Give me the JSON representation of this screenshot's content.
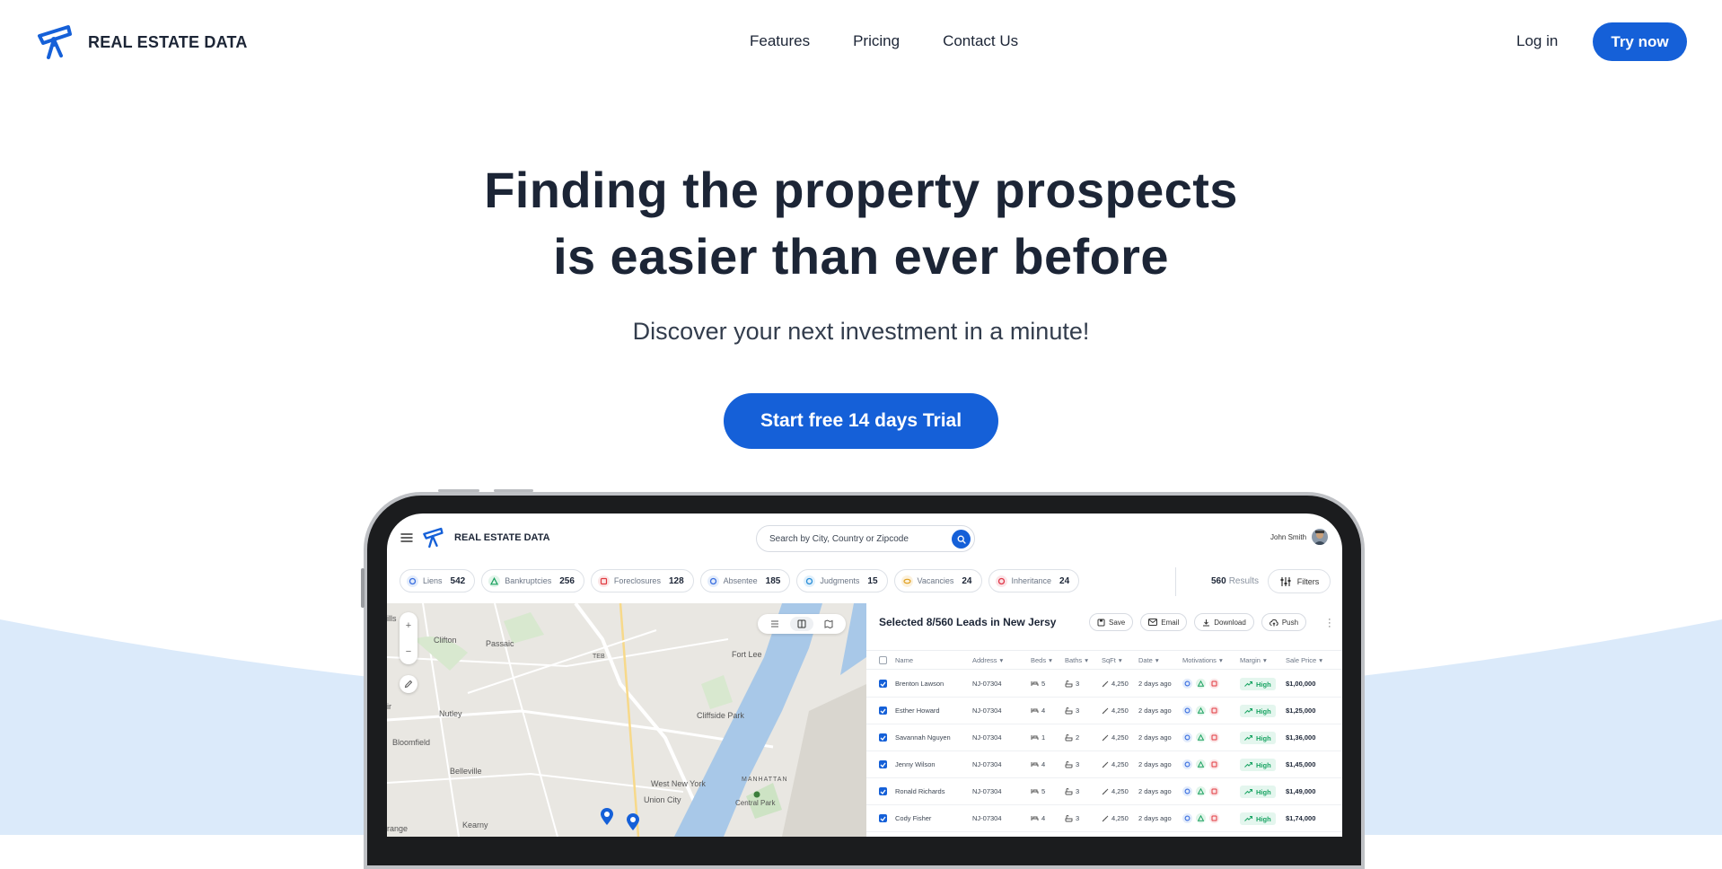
{
  "brand": {
    "name": "REAL ESTATE DATA"
  },
  "nav": {
    "links": [
      {
        "label": "Features"
      },
      {
        "label": "Pricing"
      },
      {
        "label": "Contact Us"
      }
    ],
    "login": "Log in",
    "try_now": "Try now"
  },
  "hero": {
    "title_line1": "Finding the property prospects",
    "title_line2": "is easier than ever before",
    "subtitle": "Discover your next investment in a minute!",
    "cta": "Start free 14 days Trial"
  },
  "app": {
    "brand": "REAL ESTATE DATA",
    "search_placeholder": "Search by City, Country or Zipcode",
    "user_name": "John Smith",
    "chips": [
      {
        "label": "Liens",
        "count": "542",
        "color": "#3b6fe0",
        "icon": "circle-icon"
      },
      {
        "label": "Bankruptcies",
        "count": "256",
        "color": "#18a05e",
        "icon": "triangle-icon"
      },
      {
        "label": "Foreclosures",
        "count": "128",
        "color": "#e0383e",
        "icon": "square-icon"
      },
      {
        "label": "Absentee",
        "count": "185",
        "color": "#3b6fe0",
        "icon": "circle-icon"
      },
      {
        "label": "Judgments",
        "count": "15",
        "color": "#2a8fd8",
        "icon": "circle-icon"
      },
      {
        "label": "Vacancies",
        "count": "24",
        "color": "#e0a020",
        "icon": "eye-icon"
      },
      {
        "label": "Inheritance",
        "count": "24",
        "color": "#e0384a",
        "icon": "circle-icon"
      }
    ],
    "results_count": "560",
    "results_label": "Results",
    "filters_label": "Filters",
    "map_labels": [
      "Clifton",
      "Passaic",
      "Fort Lee",
      "Nutley",
      "Cliffside Park",
      "Bloomfield",
      "Belleville",
      "West New York",
      "Union City",
      "MANHATTAN",
      "Central Park",
      "Kearny",
      "TEB",
      "ills",
      "ir",
      "range"
    ],
    "panel_title": "Selected 8/560 Leads in New Jersy",
    "actions": [
      {
        "label": "Save"
      },
      {
        "label": "Email"
      },
      {
        "label": "Download"
      },
      {
        "label": "Push"
      }
    ],
    "columns": [
      "Name",
      "Address",
      "Beds",
      "Baths",
      "SqFt",
      "Date",
      "Motivations",
      "Margin",
      "Sale Price"
    ],
    "rows": [
      {
        "name": "Brenton Lawson",
        "address": "NJ-07304",
        "beds": "5",
        "baths": "3",
        "sqft": "4,250",
        "date": "2 days ago",
        "margin": "High",
        "price": "$1,00,000"
      },
      {
        "name": "Esther Howard",
        "address": "NJ-07304",
        "beds": "4",
        "baths": "3",
        "sqft": "4,250",
        "date": "2 days ago",
        "margin": "High",
        "price": "$1,25,000"
      },
      {
        "name": "Savannah Nguyen",
        "address": "NJ-07304",
        "beds": "1",
        "baths": "2",
        "sqft": "4,250",
        "date": "2 days ago",
        "margin": "High",
        "price": "$1,36,000"
      },
      {
        "name": "Jenny Wilson",
        "address": "NJ-07304",
        "beds": "4",
        "baths": "3",
        "sqft": "4,250",
        "date": "2 days ago",
        "margin": "High",
        "price": "$1,45,000"
      },
      {
        "name": "Ronald Richards",
        "address": "NJ-07304",
        "beds": "5",
        "baths": "3",
        "sqft": "4,250",
        "date": "2 days ago",
        "margin": "High",
        "price": "$1,49,000"
      },
      {
        "name": "Cody Fisher",
        "address": "NJ-07304",
        "beds": "4",
        "baths": "3",
        "sqft": "4,250",
        "date": "2 days ago",
        "margin": "High",
        "price": "$1,74,000"
      }
    ]
  },
  "colors": {
    "accent": "#1560d8",
    "text": "#1c2536",
    "wave": "#dbeafa",
    "high": "#19a463"
  }
}
